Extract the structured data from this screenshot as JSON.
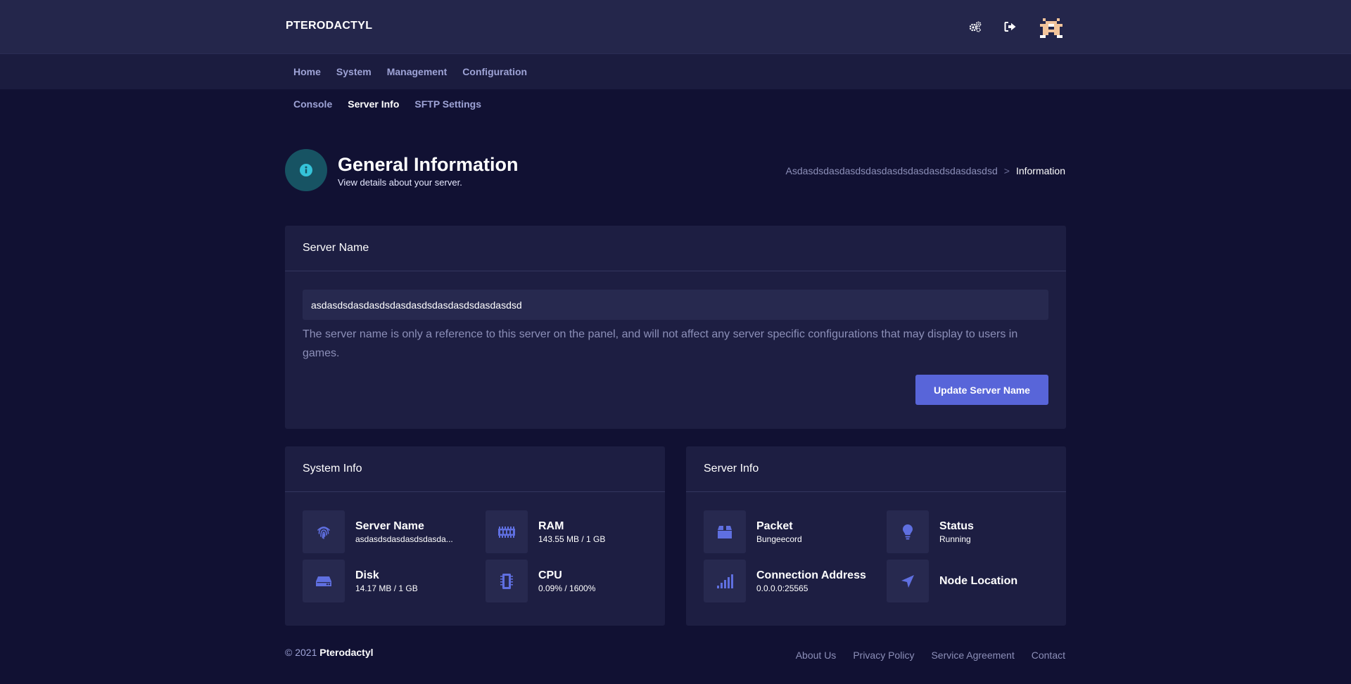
{
  "brand": "PTERODACTYL",
  "top_icons": [
    "admin-gears-icon",
    "logout-icon",
    "avatar"
  ],
  "nav": [
    "Home",
    "System",
    "Management",
    "Configuration"
  ],
  "subnav": {
    "items": [
      "Console",
      "Server Info",
      "SFTP Settings"
    ],
    "active": "Server Info"
  },
  "header": {
    "icon": "info-icon",
    "title": "General Information",
    "subtitle": "View details about your server."
  },
  "breadcrumb": {
    "server": "Asdasdsdasdasdsdasdasdsdasdasdsdasdasdsd",
    "separator": ">",
    "current": "Information"
  },
  "server_name_card": {
    "title": "Server Name",
    "input_value": "asdasdsdasdasdsdasdasdsdasdasdsdasdasdsd",
    "help_text": "The server name is only a reference to this server on the panel, and will not affect any server specific configurations that may display to users in games.",
    "button": "Update Server Name"
  },
  "system_info": {
    "title": "System Info",
    "stats": [
      {
        "icon": "fingerprint-icon",
        "label": "Server Name",
        "value": "asdasdsdasdasdsdasda..."
      },
      {
        "icon": "memory-icon",
        "label": "RAM",
        "value": "143.55 MB / 1 GB"
      },
      {
        "icon": "hdd-icon",
        "label": "Disk",
        "value": "14.17 MB / 1 GB"
      },
      {
        "icon": "microchip-icon",
        "label": "CPU",
        "value": "0.09% / 1600%"
      }
    ]
  },
  "server_info": {
    "title": "Server Info",
    "stats": [
      {
        "icon": "box-icon",
        "label": "Packet",
        "value": "Bungeecord"
      },
      {
        "icon": "lightbulb-icon",
        "label": "Status",
        "value": "Running"
      },
      {
        "icon": "signal-icon",
        "label": "Connection Address",
        "value": "0.0.0.0:25565"
      },
      {
        "icon": "location-arrow-icon",
        "label": "Node Location",
        "value": ""
      }
    ]
  },
  "footer": {
    "copyright_prefix": "© 2021",
    "copyright_brand": "Pterodactyl",
    "links": [
      "About Us",
      "Privacy Policy",
      "Service Agreement",
      "Contact"
    ]
  },
  "colors": {
    "background": "#111133",
    "topbar": "#24264b",
    "card": "#1d1e42",
    "accent": "#5865d9",
    "icon_tint": "#5f6fe0",
    "info_circle": "#175363",
    "info_icon": "#35c3d9"
  }
}
